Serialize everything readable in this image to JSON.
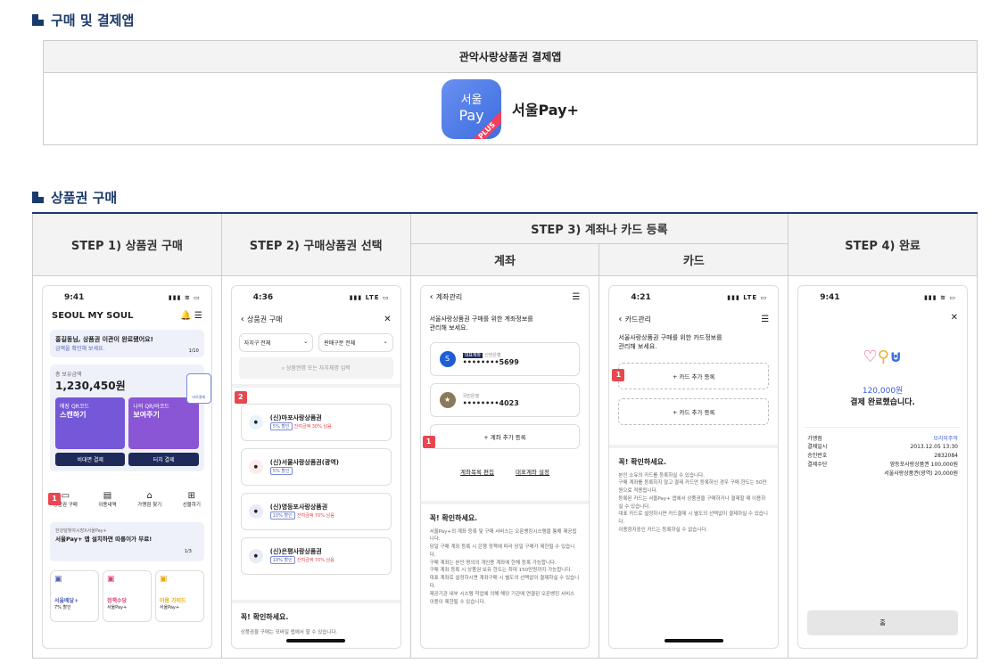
{
  "section1": {
    "title": "구매 및 결제앱",
    "box_header": "관악사랑상품권 결제앱",
    "app_icon_line1": "서울",
    "app_icon_line2": "Pay",
    "app_icon_badge": "PLUS",
    "app_name": "서울Pay+"
  },
  "section2": {
    "title": "상품권 구매",
    "headers": {
      "step1": "STEP 1) 상품권 구매",
      "step2": "STEP 2) 구매상품권 선택",
      "step3": "STEP 3) 계좌나 카드 등록",
      "step3_account": "계좌",
      "step3_card": "카드",
      "step4": "STEP 4) 완료"
    }
  },
  "p1": {
    "time": "9:41",
    "logo": "SEOUL MY SOUL",
    "notice": "홍길동님, 상품권 이관이 완료됐어요!",
    "notice_sub": "금액을 확인해 보세요.",
    "notice_page": "1/10",
    "total_label": "총 보유금액",
    "total": "1,230,450원",
    "qr_scan_label": "매장 QR코드",
    "qr_scan": "스캔하기",
    "qr_show_label": "나의 QR/바코드",
    "qr_show": "보여주기",
    "btn_contactless": "비대면 결제",
    "btn_touch": "터치 결제",
    "side_tab": "바로결제",
    "menu": [
      "상품권 구매",
      "이용내역",
      "가맹점 찾기",
      "선물하기"
    ],
    "banner_sub": "한강달빛야시장X서울Pay+",
    "banner": "서울Pay+ 앱 설치하면 따릉이가 무료!",
    "banner_page": "1/3",
    "tiles": [
      {
        "t": "서울배달+",
        "s": "7% 할인"
      },
      {
        "t": "정책수당",
        "s": "서울Pay+"
      },
      {
        "t": "이용 가이드",
        "s": "서울Pay+"
      }
    ],
    "badge": "1"
  },
  "p2": {
    "time": "4:36",
    "title": "상품권 구매",
    "filter1": "자치구 전체",
    "filter2": "판매구분 전체",
    "search": "상품권명 또는 자치체명 입력",
    "badge": "2",
    "items": [
      {
        "name": "(신)마포사랑상품권",
        "pill": "5% 할인",
        "extra": "잔여금액 30% 남음"
      },
      {
        "name": "(신)서울사랑상품권(광역)",
        "pill": "5% 할인",
        "extra": ""
      },
      {
        "name": "(신)영등포사랑상품권",
        "pill": "10% 할인",
        "extra": "잔여금액 70% 남음"
      },
      {
        "name": "(신)은평사랑상품권",
        "pill": "10% 할인",
        "extra": "잔여금액 70% 남음"
      }
    ],
    "confirm": "꼭! 확인하세요.",
    "confirm_text": "상품권을 구매는 모바일 앱에서 할 수 있습니다."
  },
  "p3": {
    "title": "계좌관리",
    "desc1": "서울사랑상품권 구매를 위한 계좌정보를",
    "desc2": "관리해 보세요.",
    "acc1_tag": "대표계좌",
    "acc1_bank": "신한은행",
    "acc1_num": "••••••••5699",
    "acc2_bank": "국민은행",
    "acc2_num": "••••••••4023",
    "add": "+ 계좌 추가 등록",
    "badge": "1",
    "link1": "계좌목록 편집",
    "link2": "대표계좌 설정",
    "confirm": "꼭! 확인하세요.",
    "notes": [
      "서울Pay+의 계좌 등록 및 구매 서비스는 오픈뱅킹시스템을 통해 제공됩니다.",
      "당일 구매 계좌 등록 시 은행 정책에 따라 당일 구매가 제한될 수 있습니다.",
      "구매 계좌는 본인 명의의 개인용 계좌에 한해 등록 가능합니다.",
      "구매 계좌 등록 시 상품권 보유 한도는 최대 150만원까지 가능합니다.",
      "대표 계좌로 설정하시면 계좌구매 시 별도의 선택없이 결제하실 수 있습니다.",
      "제공기관 내부 시스템 작업에 의해 해당 기관에 연결된 오픈뱅킹 서비스 이용이 제한될 수 있습니다."
    ]
  },
  "p4": {
    "time": "4:21",
    "title": "카드관리",
    "desc1": "서울사랑상품권 구매를 위한 카드정보를",
    "desc2": "관리해 보세요.",
    "badge": "1",
    "add1": "+ 카드 추가 등록",
    "add2": "+ 카드 추가 등록",
    "confirm": "꼭! 확인하세요.",
    "notes": [
      "본인 소유의 카드를 등록하실 수 있습니다.",
      "구매 계좌를 등록하지 않고 결제 카드만 등록하신 경우 구매 한도는 50만원으로 적용됩니다.",
      "등록된 카드는 서울Pay+ 앱에서 상품권을 구매하거나 결제할 때 이용하실 수 있습니다.",
      "대표 카드로 설정하시면 카드결제 시 별도의 선택없이 결제하실 수 있습니다.",
      "이용정지중인 카드는 등록하실 수 없습니다."
    ]
  },
  "p5": {
    "time": "9:41",
    "amount": "120,000원",
    "done": "결제 완료했습니다.",
    "rows": [
      {
        "k": "가맹점",
        "v": "모리미주막"
      },
      {
        "k": "결제일시",
        "v": "2013.12.05 13:30"
      },
      {
        "k": "승인번호",
        "v": "2832084"
      },
      {
        "k": "결제수단",
        "v": "영등포사랑상품권 100,000원"
      },
      {
        "k": "",
        "v": "서울사랑상품권(광역) 20,000원"
      }
    ],
    "home": "홈"
  }
}
